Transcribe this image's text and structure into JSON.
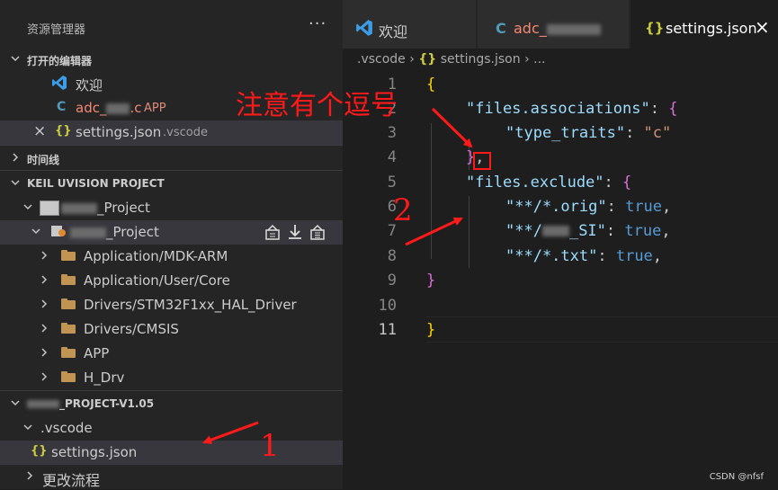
{
  "explorer": {
    "title": "资源管理器",
    "more": "···",
    "open_editors": {
      "header": "打开的编辑器",
      "items": [
        {
          "label": "欢迎",
          "detail": ""
        },
        {
          "label_pre": "adc_",
          "label_post": ".c",
          "detail": "APP"
        },
        {
          "label": "settings.json",
          "detail": ".vscode",
          "close": "×"
        }
      ]
    },
    "timeline": {
      "header": "时间线"
    },
    "keil": {
      "header": "KEIL UVISION PROJECT",
      "project_row": "_Project",
      "target_row": "_Project",
      "groups": [
        "Application/MDK-ARM",
        "Application/User/Core",
        "Drivers/STM32F1xx_HAL_Driver",
        "Drivers/CMSIS",
        "APP",
        "H_Drv"
      ]
    },
    "workspace": {
      "header": "_PROJECT-V1.05",
      "folder": ".vscode",
      "file": "settings.json",
      "next_section": "更改流程"
    }
  },
  "tabs": [
    {
      "label": "欢迎"
    },
    {
      "label_pre": "adc_"
    },
    {
      "label": "settings.json",
      "close": "×"
    }
  ],
  "breadcrumb": {
    "folder": ".vscode",
    "sep1": "›",
    "file": "settings.json",
    "sep2": "›",
    "tail": "..."
  },
  "code": {
    "line_numbers": [
      "1",
      "2",
      "3",
      "4",
      "5",
      "6",
      "7",
      "8",
      "9",
      "10",
      "11"
    ],
    "l1": "{",
    "l2_key": "\"files.associations\"",
    "l2_colon": ": ",
    "l2_brace": "{",
    "l3_key": "\"type_traits\"",
    "l3_colon": ": ",
    "l3_val": "\"c\"",
    "l4_brace": "}",
    "l4_comma": ",",
    "l5_key": "\"files.exclude\"",
    "l5_colon": ": ",
    "l5_brace": "{",
    "l6_key": "\"**/*.orig\"",
    "l6_colon": ": ",
    "l6_val": "true",
    "l6_comma": ",",
    "l7_key_pre": "\"**/",
    "l7_key_post": "_SI\"",
    "l7_colon": ": ",
    "l7_val": "true",
    "l7_comma": ",",
    "l8_key": "\"**/*.txt\"",
    "l8_colon": ": ",
    "l8_val": "true",
    "l8_comma": ",",
    "l9_brace": "}",
    "l11_brace": "}"
  },
  "annotations": {
    "note": "注意有个逗号",
    "num2": "2",
    "num1": "1"
  },
  "watermark": "CSDN @nfsf",
  "colors": {
    "annotation": "#ff1a1a",
    "string_key": "#9cdcfe",
    "string_value": "#ce9178",
    "keyword_true": "#569cd6"
  }
}
